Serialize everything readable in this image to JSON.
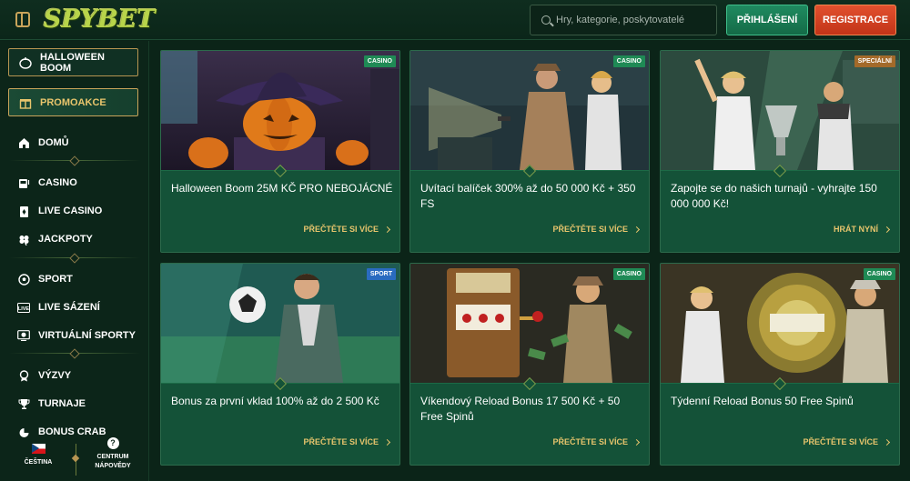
{
  "header": {
    "logo_text": "SPYBET",
    "search_placeholder": "Hry, kategorie, poskytovatelé",
    "login_label": "PŘIHLÁŠENÍ",
    "register_label": "REGISTRACE"
  },
  "sidebar": {
    "halloween": "HALLOWEEN BOOM",
    "promo": "PROMOAKCE",
    "items": [
      {
        "label": "DOMŮ",
        "icon": "home-icon"
      },
      {
        "label": "CASINO",
        "icon": "slot-machine-icon"
      },
      {
        "label": "LIVE CASINO",
        "icon": "cards-icon"
      },
      {
        "label": "JACKPOTY",
        "icon": "clover-icon"
      },
      {
        "label": "SPORT",
        "icon": "soccer-ball-icon"
      },
      {
        "label": "LIVE SÁZENÍ",
        "icon": "live-icon"
      },
      {
        "label": "VIRTUÁLNÍ SPORTY",
        "icon": "virtual-sport-icon"
      },
      {
        "label": "VÝZVY",
        "icon": "medal-icon"
      },
      {
        "label": "TURNAJE",
        "icon": "trophy-icon"
      },
      {
        "label": "BONUS CRAB",
        "icon": "crab-icon"
      }
    ],
    "language": "ČEŠTINA",
    "help_line1": "CENTRUM",
    "help_line2": "NÁPOVĚDY"
  },
  "cards": [
    {
      "badge": "CASINO",
      "title": "Halloween Boom 25M KČ PRO NEBOJÁCNÉ",
      "cta": "PŘEČTĚTE SI VÍCE"
    },
    {
      "badge": "CASINO",
      "title": "Uvítací balíček 300% až do 50 000 Kč + 350 FS",
      "cta": "PŘEČTĚTE SI VÍCE"
    },
    {
      "badge": "SPECIÁLNÍ",
      "title": "Zapojte se do našich turnajů - vyhrajte 150 000 000 Kč!",
      "cta": "HRÁT NYNÍ"
    },
    {
      "badge": "SPORT",
      "title": "Bonus za první vklad 100% až do 2 500 Kč",
      "cta": "PŘEČTĚTE SI VÍCE"
    },
    {
      "badge": "CASINO",
      "title": "Víkendový Reload Bonus 17 500 Kč + 50 Free Spinů",
      "cta": "PŘEČTĚTE SI VÍCE"
    },
    {
      "badge": "CASINO",
      "title": "Týdenní Reload Bonus 50 Free Spinů",
      "cta": "PŘEČTĚTE SI VÍCE"
    }
  ],
  "colors": {
    "background": "#0b2418",
    "card": "#145238",
    "accent_gold": "#e8c56c",
    "login": "#1f8a60",
    "register": "#e2502e"
  }
}
